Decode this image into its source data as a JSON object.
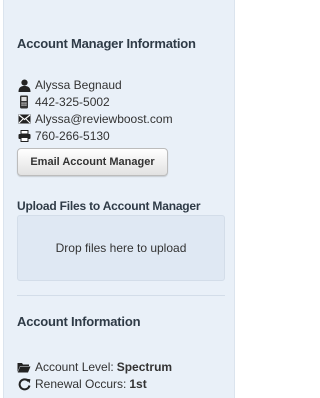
{
  "account_manager": {
    "heading": "Account Manager Information",
    "name": "Alyssa Begnaud",
    "phone": "442-325-5002",
    "email": "Alyssa@reviewboost.com",
    "fax": "760-266-5130",
    "email_button_label": "Email Account Manager"
  },
  "upload": {
    "heading": "Upload Files to Account Manager",
    "dropzone_text": "Drop files here to upload"
  },
  "account_info": {
    "heading": "Account Information",
    "level_label": "Account Level:",
    "level_value": "Spectrum",
    "renewal_label": "Renewal Occurs:",
    "renewal_value": "1st"
  },
  "icons": {
    "user": "user-icon",
    "phone": "phone-icon",
    "email": "envelope-icon",
    "fax": "printer-icon",
    "folder": "folder-icon",
    "renew": "refresh-icon"
  },
  "colors": {
    "panel_background": "#e9f0f8",
    "dropzone_background": "#dfe8f3",
    "heading_text": "#2f3b47"
  }
}
